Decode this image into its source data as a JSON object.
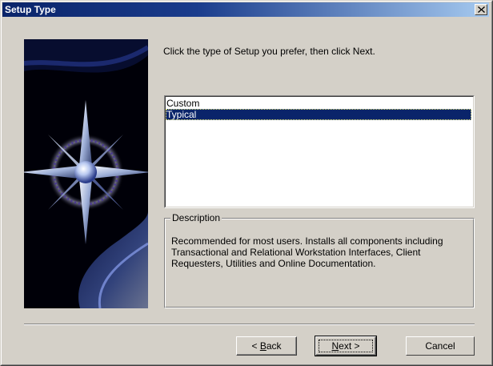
{
  "window": {
    "title": "Setup Type",
    "close_glyph": "✕"
  },
  "banner": {
    "icon": "compass-star-graphic"
  },
  "instruction": "Click the type of Setup you prefer, then click Next.",
  "setup_types": {
    "options": [
      "Custom",
      "Typical"
    ],
    "selected": "Typical"
  },
  "description": {
    "legend": "Description",
    "text": "Recommended for most users.  Installs all components including Transactional and Relational Workstation Interfaces, Client Requesters, Utilities and Online Documentation."
  },
  "buttons": {
    "back_prefix": "< ",
    "back_accel": "B",
    "back_rest": "ack",
    "next_accel": "N",
    "next_rest": "ext >",
    "cancel": "Cancel"
  },
  "colors": {
    "title_bar": "#0a246a",
    "selection": "#0a246a",
    "dialog_face": "#d4d0c8"
  }
}
